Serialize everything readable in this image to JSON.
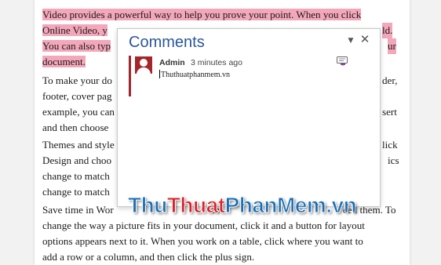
{
  "document": {
    "p1_lines": [
      "Video provides a powerful way to help you prove your point. When you click",
      "Online Video, y",
      "ld.",
      "You can also typ",
      "ur",
      "document."
    ],
    "p2_lines": [
      "To make your do",
      "der,",
      "footer, cover pag",
      "example, you can",
      "sert",
      "and then choose"
    ],
    "p3_lines": [
      "Themes and style",
      "lick",
      "Design and choo",
      "ics",
      "change to match",
      "change to match"
    ],
    "p4_lines": [
      "Save time in Wor",
      "th",
      "eed them. To",
      "change the way a picture fits in your document, click it and a button for layout",
      "options appears next to it. When you work on a table, click where you want to",
      "add a row or a column, and then click the plus sign."
    ]
  },
  "comments_pane": {
    "title": "Comments",
    "comment": {
      "author": "Admin",
      "time": "3 minutes ago",
      "text": "Thuthuatphanmem.vn"
    }
  },
  "watermark": {
    "part1": "Thu",
    "part2": "Thuat",
    "part3": "PhanMem.vn"
  }
}
